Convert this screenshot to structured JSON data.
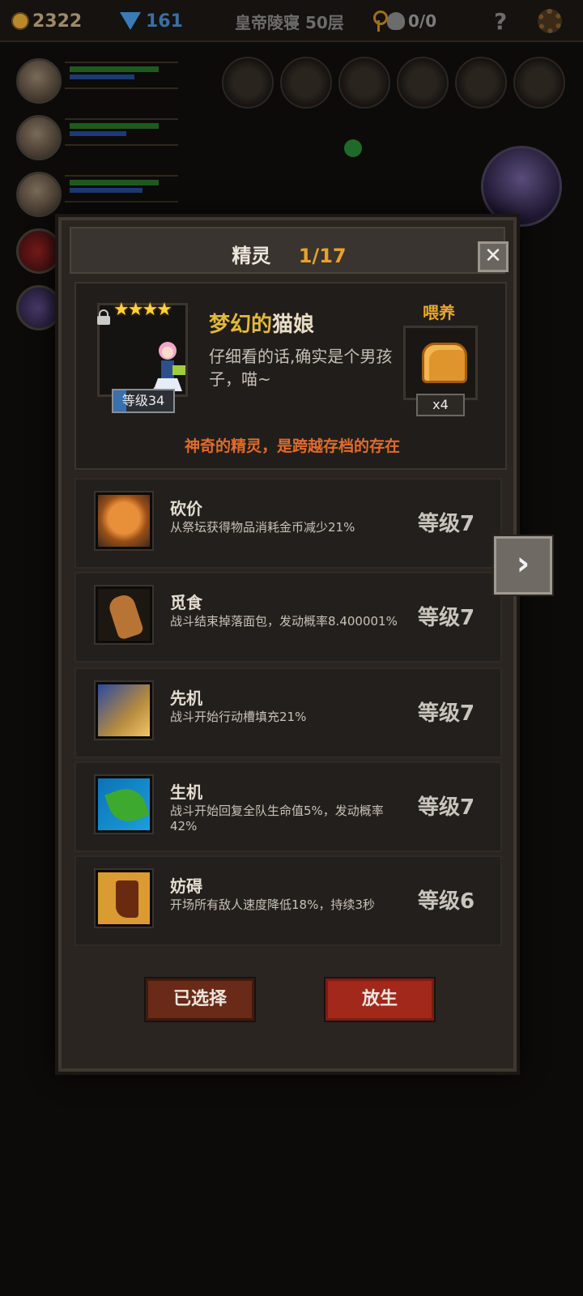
{
  "topbar": {
    "gold": "2322",
    "gems": "161",
    "location": "皇帝陵寝 50层",
    "keys_skulls": "0/0",
    "help": "?"
  },
  "colors": {
    "accent_orange": "#e8a12c",
    "tagline_red": "#e06b2e",
    "release_red": "#a3281c",
    "selected_brown": "#6a2a18"
  },
  "dialog": {
    "title": "精灵",
    "page": "1/17",
    "close_icon": "close-icon",
    "spirit": {
      "stars": "★★★★",
      "name_prefix": "梦幻的",
      "name_suffix": "猫娘",
      "description": "仔细看的话,确实是个男孩子，喵~",
      "level_badge": "等级34",
      "level_progress": 0.2,
      "locked": true
    },
    "feed": {
      "label": "喂养",
      "item_icon": "bread-icon",
      "count": "x4"
    },
    "tagline": "神奇的精灵，是跨越存档的存在",
    "skills": [
      {
        "name": "砍价",
        "desc": "从祭坛获得物品消耗金币减少21%",
        "level": "等级7",
        "icon": "coupon-icon"
      },
      {
        "name": "觅食",
        "desc": "战斗结束掉落面包，发动概率8.400001%",
        "level": "等级7",
        "icon": "gingerbread-icon"
      },
      {
        "name": "先机",
        "desc": "战斗开始行动槽填充21%",
        "level": "等级7",
        "icon": "leopard-icon"
      },
      {
        "name": "生机",
        "desc": "战斗开始回复全队生命值5%，发动概率42%",
        "level": "等级7",
        "icon": "leaf-icon"
      },
      {
        "name": "妨碍",
        "desc": "开场所有敌人速度降低18%，持续3秒",
        "level": "等级6",
        "icon": "chained-boot-icon"
      }
    ],
    "buttons": {
      "selected": "已选择",
      "release": "放生"
    },
    "next_icon": "chevron-right-icon"
  }
}
